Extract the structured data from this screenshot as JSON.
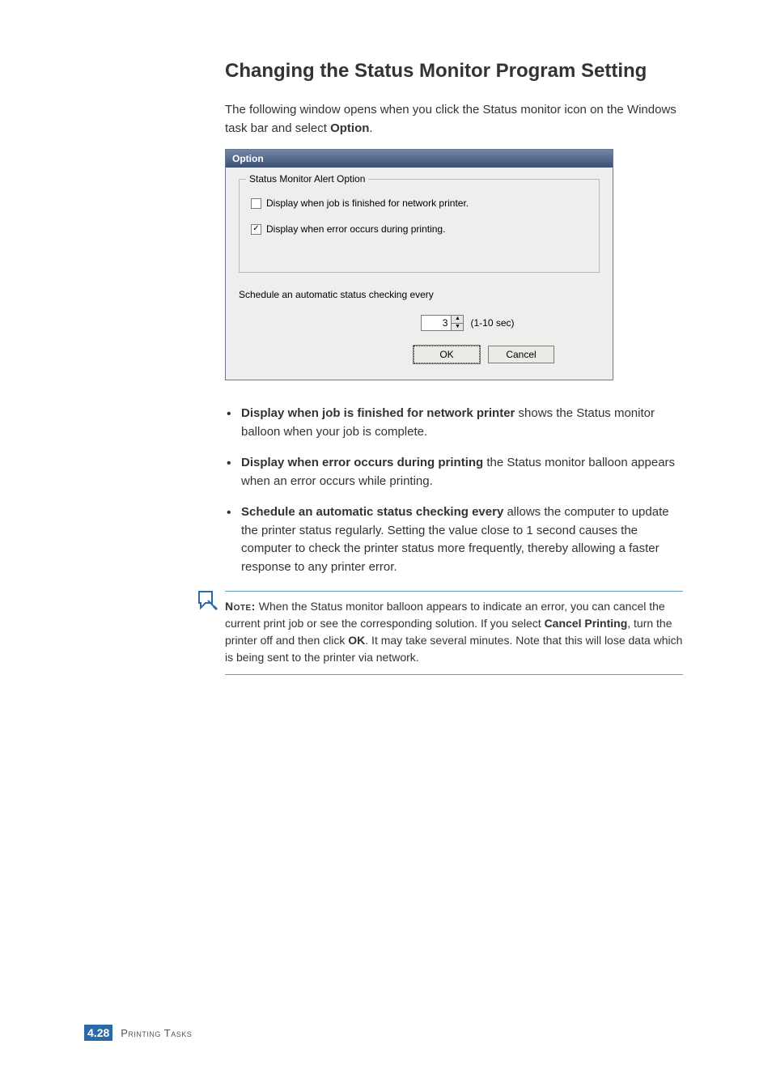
{
  "heading": "Changing the Status Monitor Program Setting",
  "intro": {
    "pre": "The following window opens when you click the Status monitor icon on the Windows task bar and select ",
    "bold": "Option",
    "post": "."
  },
  "dialog": {
    "title": "Option",
    "fieldset_legend": "Status Monitor Alert Option",
    "chk_network": {
      "checked": false,
      "label": "Display when job is finished for network printer."
    },
    "chk_error": {
      "checked": true,
      "label": "Display when error occurs during printing."
    },
    "schedule_label": "Schedule an automatic status checking every",
    "spinner": {
      "value": "3",
      "unit": "(1-10 sec)"
    },
    "ok": "OK",
    "cancel": "Cancel"
  },
  "bullets": {
    "b1_bold": "Display when job is finished for network printer",
    "b1_rest": " shows the Status monitor balloon when your job is complete.",
    "b2_bold": "Display when error occurs during printing",
    "b2_rest": " the Status monitor balloon appears when an error occurs while printing.",
    "b3_bold": "Schedule an automatic status checking every",
    "b3_rest": " allows the computer to update the printer status regularly. Setting the value close to 1 second causes the computer to check the printer status more frequently, thereby allowing a faster response to any printer error."
  },
  "note": {
    "label": "Note:",
    "t1": " When the Status monitor balloon appears to indicate an error, you can cancel the current print job or see the corresponding solution. If you select ",
    "bold1": "Cancel Printing",
    "t2": ", turn the printer off and then click ",
    "bold2": "OK",
    "t3": ". It may take several minutes. Note that this will lose data which is being sent to the printer via network."
  },
  "footer": {
    "chapter": "4.",
    "page": "28",
    "label": "Printing Tasks"
  }
}
